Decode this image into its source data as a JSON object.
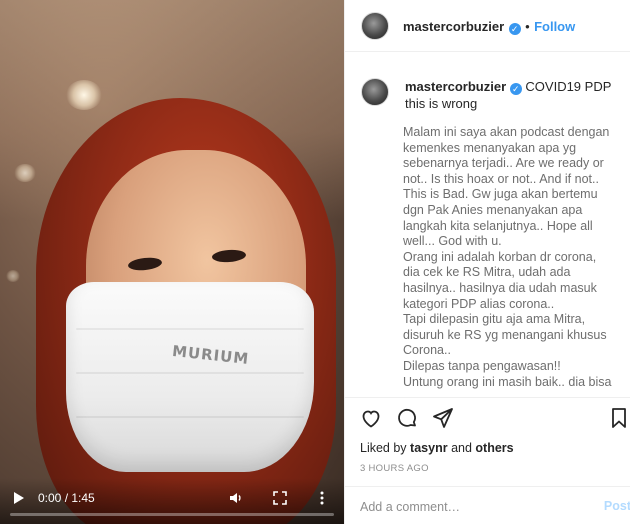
{
  "video": {
    "time": "0:00 / 1:45",
    "progress": 0.0,
    "mask_text": "MURIUM",
    "icons": [
      "play-icon",
      "volume-icon",
      "fullscreen-icon",
      "more-icon"
    ]
  },
  "header": {
    "username": "mastercorbuzier",
    "separator": "•",
    "follow_label": "Follow"
  },
  "caption": {
    "username": "mastercorbuzier",
    "title": "COVID19 PDP this is wrong",
    "body": "Malam ini saya akan podcast dengan kemenkes menanyakan apa yg sebenarnya terjadi.. Are we ready or not.. Is this hoax or not.. And if not.. This is Bad. Gw juga akan bertemu dgn Pak Anies menanyakan apa langkah kita selanjutnya.. Hope all well... God with u.\nOrang ini adalah korban dr corona, dia cek ke RS Mitra, udah ada hasilnya.. hasilnya dia udah masuk kategori PDP alias corona..\nTapi dilepasin gitu aja ama Mitra, disuruh ke RS yg menangani khusus Corona..\nDilepas tanpa pengawasan!!\nUntung orang ini masih baik.. dia bisa"
  },
  "actions": {
    "icons": [
      "heart-icon",
      "comment-icon",
      "share-icon",
      "bookmark-icon"
    ]
  },
  "likes": {
    "prefix": "Liked by",
    "user": "tasynr",
    "and": "and",
    "others": "others"
  },
  "time_ago": "3 HOURS AGO",
  "comment": {
    "placeholder": "Add a comment…",
    "post_label": "Post"
  },
  "colors": {
    "accent": "#3897f0",
    "post_disabled": "#b3dbff",
    "muted_text": "#8e8e8e"
  }
}
